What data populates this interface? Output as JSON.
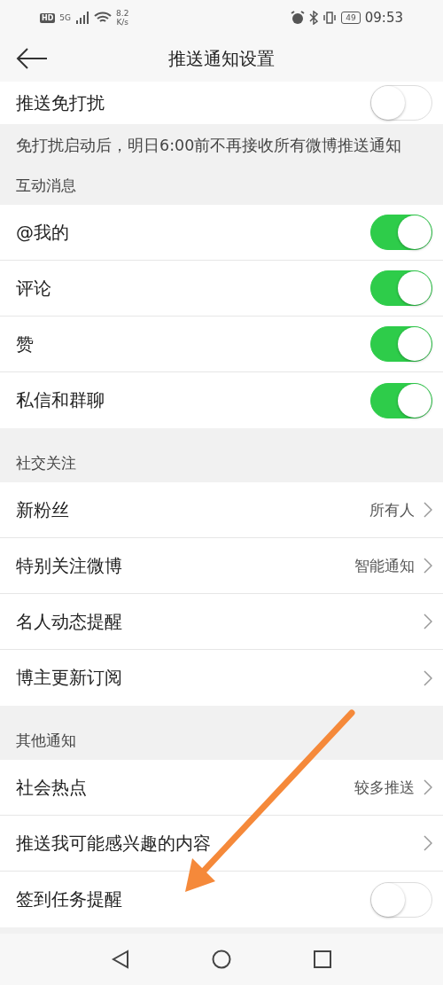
{
  "status_bar": {
    "hd": "HD",
    "network": "5G",
    "speed_value": "8.2",
    "speed_unit": "K/s",
    "battery": "49",
    "time": "09:53"
  },
  "header": {
    "title": "推送通知设置"
  },
  "top_row": {
    "label": "推送免打扰",
    "kind": "toggle",
    "on": false
  },
  "note": "免打扰启动后，明日6:00前不再接收所有微博推送通知",
  "sections": [
    {
      "title": "互动消息",
      "items": [
        {
          "label": "@我的",
          "kind": "toggle",
          "on": true
        },
        {
          "label": "评论",
          "kind": "toggle",
          "on": true
        },
        {
          "label": "赞",
          "kind": "toggle",
          "on": true
        },
        {
          "label": "私信和群聊",
          "kind": "toggle",
          "on": true
        }
      ]
    },
    {
      "title": "社交关注",
      "items": [
        {
          "label": "新粉丝",
          "kind": "link",
          "value": "所有人"
        },
        {
          "label": "特别关注微博",
          "kind": "link",
          "value": "智能通知"
        },
        {
          "label": "名人动态提醒",
          "kind": "link"
        },
        {
          "label": "博主更新订阅",
          "kind": "link"
        }
      ]
    },
    {
      "title": "其他通知",
      "items": [
        {
          "label": "社会热点",
          "kind": "link",
          "value": "较多推送"
        },
        {
          "label": "推送我可能感兴趣的内容",
          "kind": "link"
        },
        {
          "label": "签到任务提醒",
          "kind": "toggle",
          "on": false
        }
      ]
    }
  ]
}
